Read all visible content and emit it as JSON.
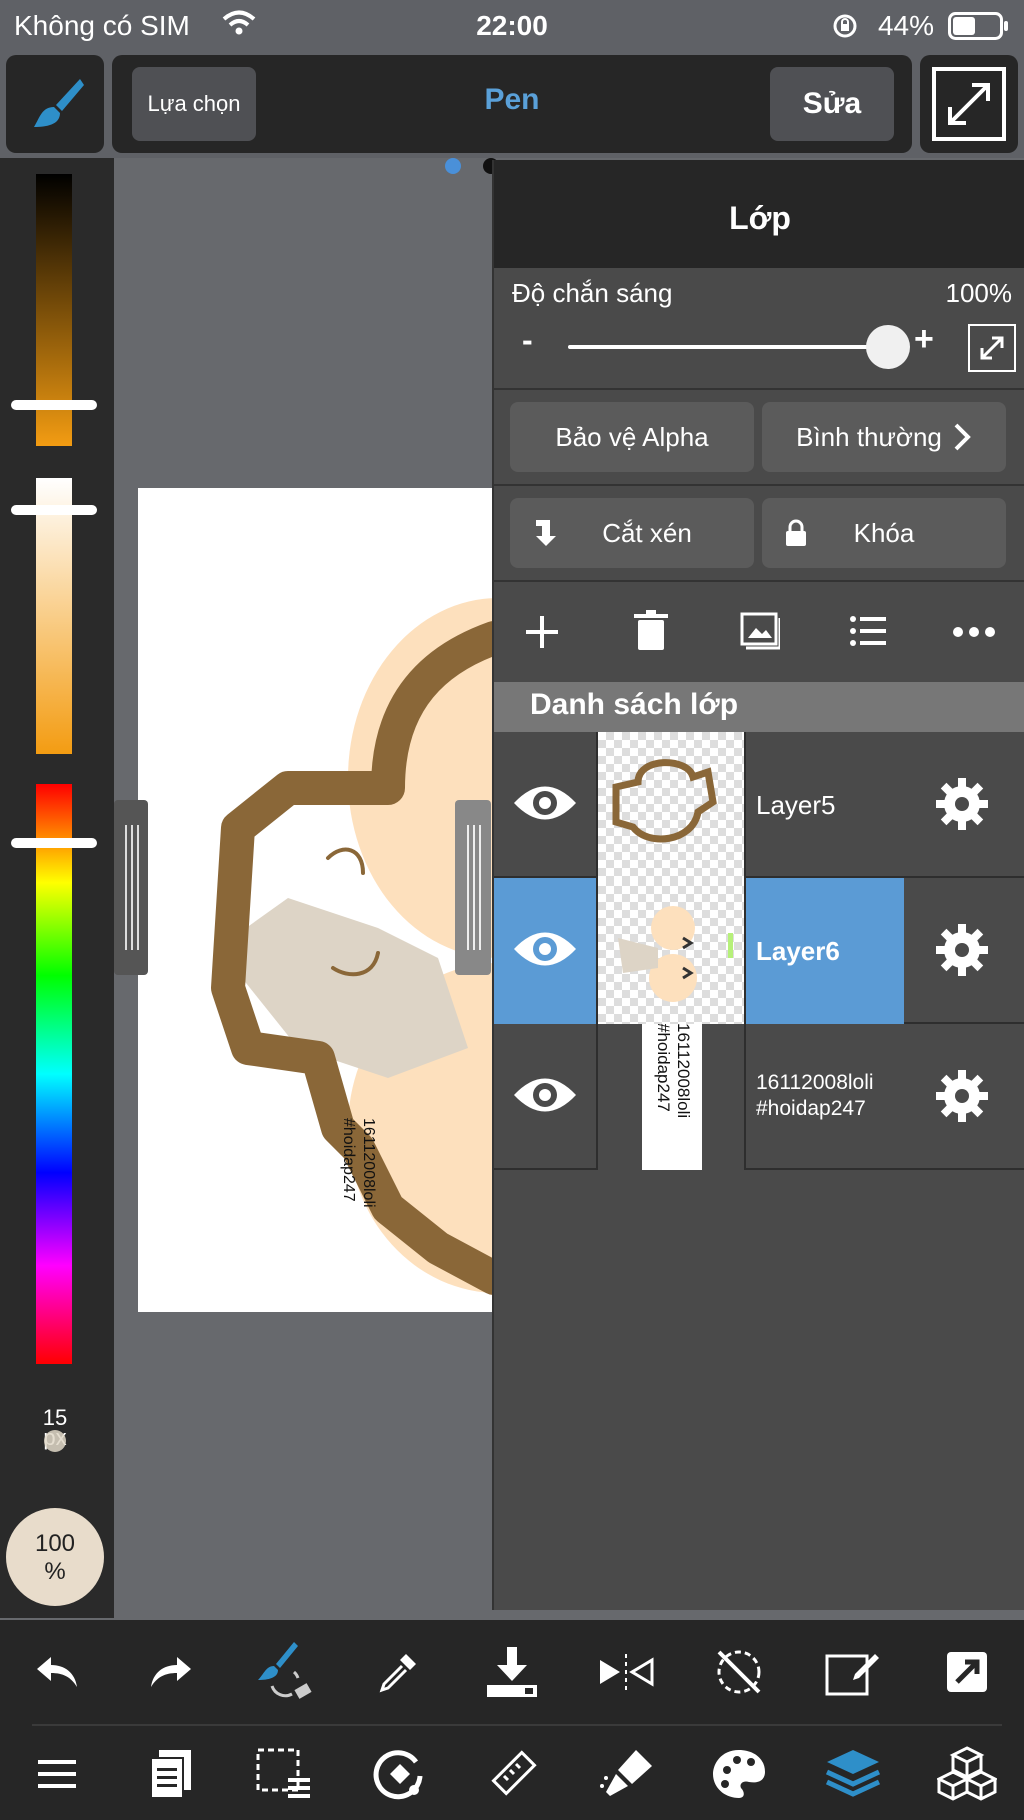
{
  "status_bar": {
    "carrier": "Không có SIM",
    "time": "22:00",
    "battery": "44%"
  },
  "toolbar": {
    "select_label": "Lựa chọn",
    "tool_name": "Pen",
    "edit_label": "Sửa"
  },
  "brush": {
    "size": "15",
    "size_unit": "px",
    "opacity": "100",
    "opacity_unit": "%"
  },
  "canvas": {
    "watermark_line1": "16112008loli",
    "watermark_line2": "#hoidap247"
  },
  "layers_panel": {
    "title": "Lớp",
    "opacity_label": "Độ chắn sáng",
    "opacity_value": "100%",
    "opacity_level": 1.0,
    "minus": "-",
    "plus": "+",
    "alpha_protect": "Bảo vệ Alpha",
    "blend_mode": "Bình thường",
    "clipping": "Cắt xén",
    "lock": "Khóa",
    "list_header": "Danh sách lớp",
    "layers": [
      {
        "name": "Layer5",
        "selected": false
      },
      {
        "name": "Layer6",
        "selected": true
      },
      {
        "name_line1": "16112008loli",
        "name_line2": "#hoidap247",
        "selected": false
      }
    ]
  },
  "colors": {
    "accent": "#5aa0d8",
    "selected_layer": "#5b9bd5",
    "brush_icon": "#2e8fc9",
    "skin": "#fde0bd",
    "hair": "#8a6738"
  },
  "icons": {
    "top": [
      "brush-icon",
      "fullscreen-icon"
    ],
    "layer_actions": [
      "add-layer-icon",
      "trash-icon",
      "image-icon",
      "list-icon",
      "more-icon"
    ],
    "tools_row1": [
      "undo-icon",
      "redo-icon",
      "brush-swap-icon",
      "eyedropper-icon",
      "save-icon",
      "flip-icon",
      "rotate-off-icon",
      "edit-icon",
      "share-icon"
    ],
    "tools_row2": [
      "menu-icon",
      "pages-icon",
      "selection-icon",
      "transform-icon",
      "ruler-icon",
      "brush-tool-icon",
      "palette-icon",
      "layers-icon",
      "materials-icon"
    ]
  }
}
